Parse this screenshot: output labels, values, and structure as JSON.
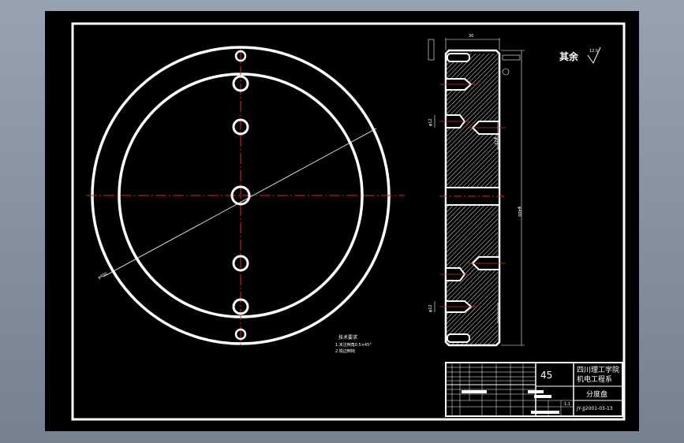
{
  "roughness": {
    "label": "其余",
    "value": "12.5"
  },
  "notes": {
    "title": "技术要求",
    "line1": "1.未注倒角0.5×45°",
    "line2": "2.锐边倒钝"
  },
  "front_view": {
    "diameter_label": "φ400"
  },
  "section_view": {
    "width_label": "30",
    "height_label": "φ400",
    "hole_label_1": "φ12",
    "hole_label_2": "φ20",
    "hole_label_3": "φ12"
  },
  "title_block": {
    "material": "45",
    "school_line1": "四川理工学院",
    "school_line2": "机电工程系",
    "part_name": "分度盘",
    "scale": "1:1",
    "drawing_no": "JY-JJ2001-03-13"
  },
  "colors": {
    "sheet": "#000000",
    "line": "#ffffff",
    "centerline": "#e0242b",
    "app_background": "#8a96a4"
  }
}
